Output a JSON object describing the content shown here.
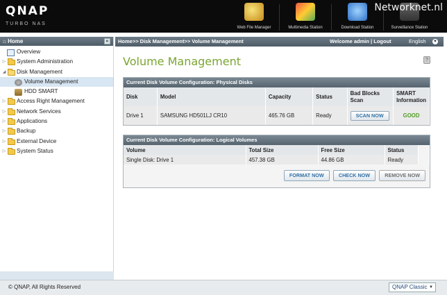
{
  "header": {
    "brand": "QNAP",
    "brand_sub": "TURBO NAS",
    "watermark": "Networknet.nl",
    "apps": [
      {
        "label": "Web File Manager",
        "icon": "web-file-manager-icon"
      },
      {
        "label": "Multimedia Station",
        "icon": "multimedia-station-icon"
      },
      {
        "label": "Download Station",
        "icon": "download-station-icon"
      },
      {
        "label": "Surveillance Station",
        "icon": "surveillance-station-icon"
      }
    ]
  },
  "sidebar": {
    "title": "Home",
    "items": [
      {
        "label": "Overview",
        "level": 1,
        "type": "page"
      },
      {
        "label": "System Administration",
        "level": 0,
        "type": "folder",
        "arrow": "▷"
      },
      {
        "label": "Disk Management",
        "level": 0,
        "type": "folder",
        "arrow": "◢"
      },
      {
        "label": "Volume Management",
        "level": 2,
        "type": "page",
        "selected": true
      },
      {
        "label": "HDD SMART",
        "level": 2,
        "type": "page"
      },
      {
        "label": "Access Right Management",
        "level": 0,
        "type": "folder",
        "arrow": "▷"
      },
      {
        "label": "Network Services",
        "level": 0,
        "type": "folder",
        "arrow": "▷"
      },
      {
        "label": "Applications",
        "level": 0,
        "type": "folder",
        "arrow": "▷"
      },
      {
        "label": "Backup",
        "level": 0,
        "type": "folder",
        "arrow": "▷"
      },
      {
        "label": "External Device",
        "level": 0,
        "type": "folder",
        "arrow": "▷"
      },
      {
        "label": "System Status",
        "level": 0,
        "type": "folder",
        "arrow": "▷"
      }
    ]
  },
  "topbar": {
    "breadcrumb": "Home>> Disk Management>> Volume Management",
    "welcome": "Welcome admin",
    "logout": "Logout",
    "language": "English"
  },
  "main": {
    "title": "Volume Management",
    "physical": {
      "heading": "Current Disk Volume Configuration: Physical Disks",
      "columns": [
        "Disk",
        "Model",
        "Capacity",
        "Status",
        "Bad Blocks Scan",
        "SMART Information"
      ],
      "row": {
        "disk": "Drive 1",
        "model": "SAMSUNG HD501LJ CR10",
        "capacity": "465.76 GB",
        "status": "Ready",
        "scan_button": "SCAN NOW",
        "smart": "GOOD"
      }
    },
    "logical": {
      "heading": "Current Disk Volume Configuration: Logical Volumes",
      "columns": [
        "Volume",
        "Total Size",
        "Free Size",
        "Status"
      ],
      "row": {
        "volume": "Single Disk: Drive 1",
        "total": "457.38 GB",
        "free": "44.86 GB",
        "status": "Ready"
      },
      "buttons": {
        "format": "FORMAT NOW",
        "check": "CHECK NOW",
        "remove": "REMOVE NOW"
      }
    }
  },
  "footer": {
    "copyright": "© QNAP, All Rights Reserved",
    "theme": "QNAP Classic"
  },
  "colors": {
    "accent_green": "#7aa532",
    "header_bg": "#0b0b0b",
    "bar_bg": "#56646f"
  }
}
